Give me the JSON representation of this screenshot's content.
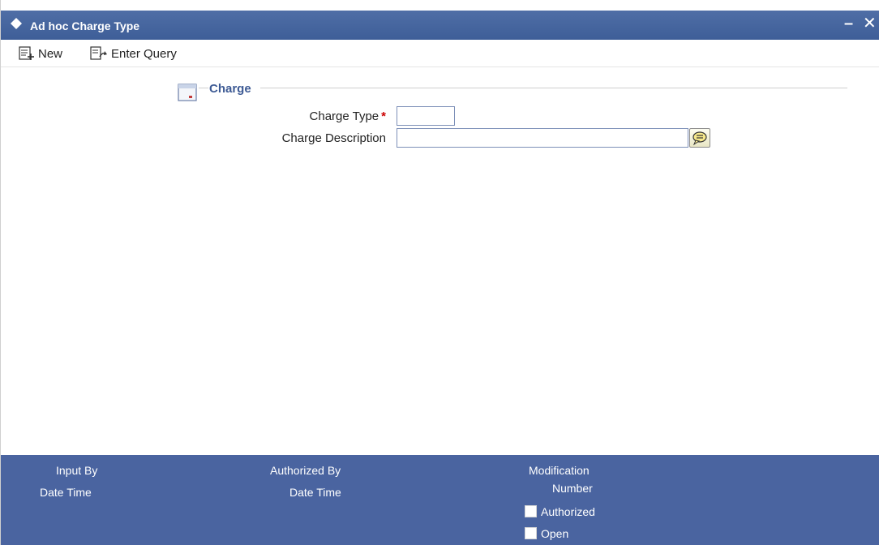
{
  "window": {
    "title": "Ad hoc Charge Type",
    "minimize_glyph": "–",
    "close_glyph": "✕"
  },
  "toolbar": {
    "new_label": "New",
    "query_label": "Enter Query"
  },
  "section": {
    "title": "Charge"
  },
  "form": {
    "charge_type_label": "Charge Type",
    "required_marker": "*",
    "charge_type_value": "",
    "charge_description_label": "Charge Description",
    "charge_description_value": ""
  },
  "footer": {
    "input_by": "Input By",
    "date_time_1": "Date Time",
    "authorized_by": "Authorized By",
    "date_time_2": "Date Time",
    "modification": "Modification",
    "number": "Number",
    "authorized_label": "Authorized",
    "authorized_checked": false,
    "open_label": "Open",
    "open_checked": false
  },
  "colors": {
    "titlebar": "#4467a3",
    "footer": "#4a64a0",
    "section_title": "#3d5a94",
    "required": "#cc0000"
  },
  "icons": {
    "title": "diamond-icon",
    "new": "new-record-icon",
    "query": "enter-query-icon",
    "section": "section-collapse-icon",
    "lov": "speech-bubble-icon"
  }
}
